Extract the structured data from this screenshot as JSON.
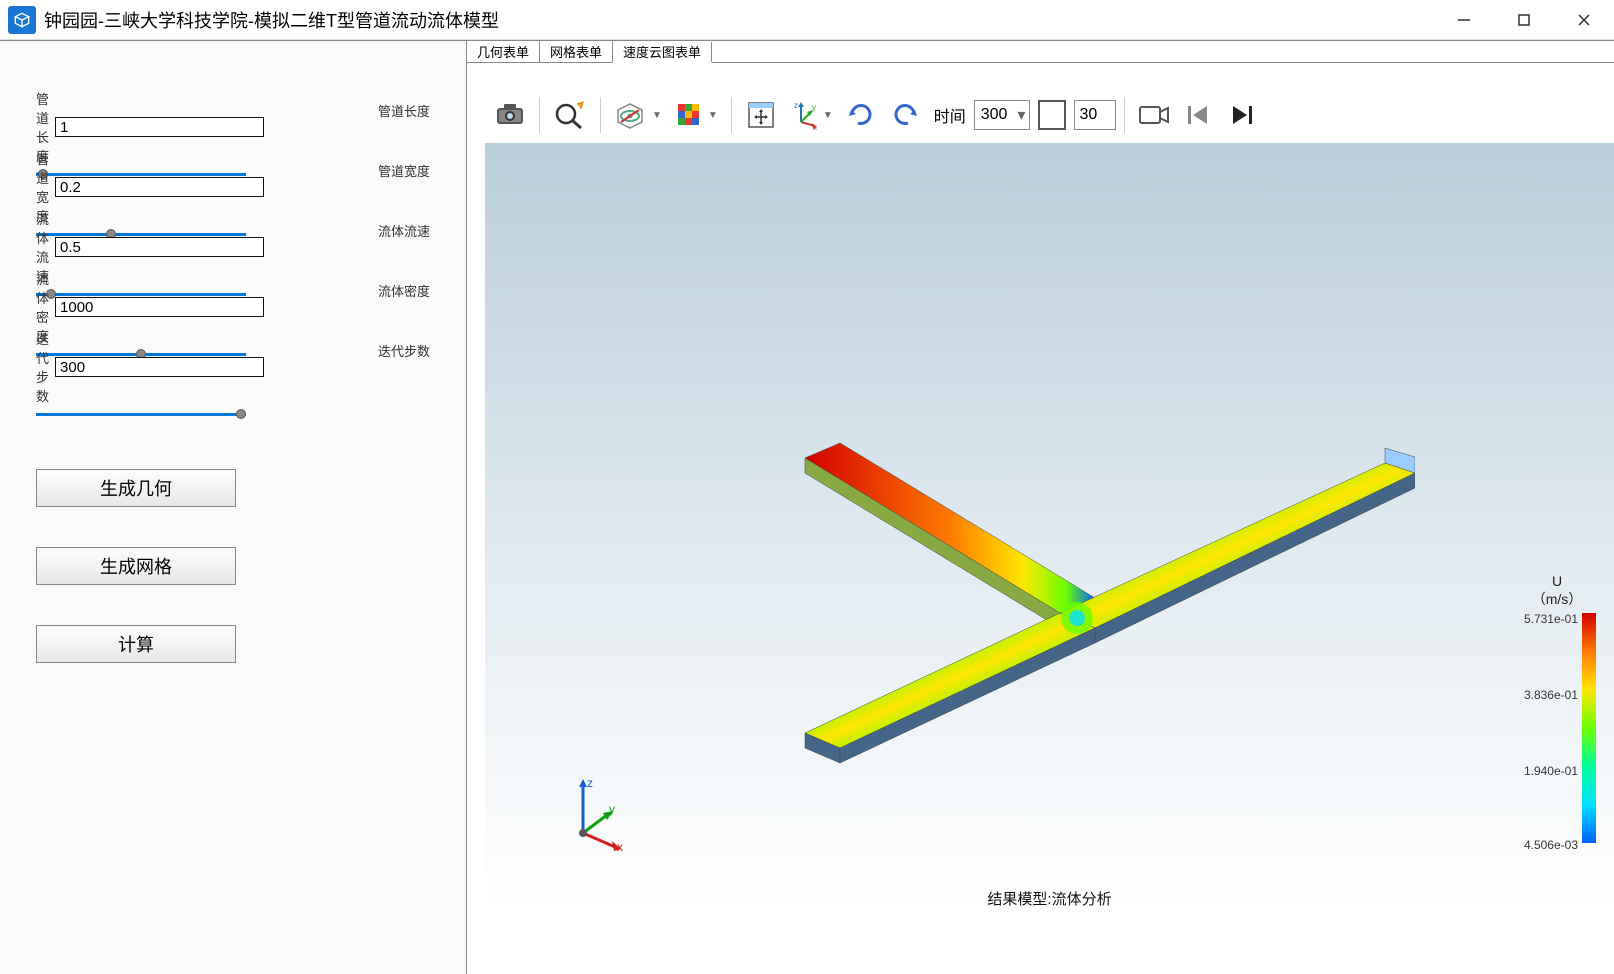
{
  "window": {
    "title": "钟园园-三峡大学科技学院-模拟二维T型管道流动流体模型"
  },
  "params": [
    {
      "label": "管道长度",
      "value": "1",
      "right": "管道长度",
      "min": 0,
      "max": 10,
      "pos": 1
    },
    {
      "label": "管道宽度",
      "value": "0.2",
      "right": "管道宽度",
      "min": 0,
      "max": 1,
      "pos": 35
    },
    {
      "label": "流体流速",
      "value": "0.5",
      "right": "流体流速",
      "min": 0,
      "max": 10,
      "pos": 5
    },
    {
      "label": "流体密度",
      "value": "1000",
      "right": "流体密度",
      "min": 0,
      "max": 2000,
      "pos": 50
    },
    {
      "label": "迭代步数",
      "value": "300",
      "right": "迭代步数",
      "min": 0,
      "max": 300,
      "pos": 100
    }
  ],
  "buttons": {
    "geometry": "生成几何",
    "mesh": "生成网格",
    "compute": "计算"
  },
  "tabs": [
    "几何表单",
    "网格表单",
    "速度云图表单"
  ],
  "active_tab": 2,
  "toolbar": {
    "time_label": "时间",
    "time_value": "300",
    "frame_value": "30"
  },
  "viewport": {
    "footer": "结果模型:流体分析",
    "triad": {
      "x": "x",
      "y": "y",
      "z": "z"
    }
  },
  "colorbar": {
    "title": "U",
    "unit": "（m/s）",
    "ticks": [
      "5.731e-01",
      "3.836e-01",
      "1.940e-01",
      "4.506e-03"
    ]
  }
}
